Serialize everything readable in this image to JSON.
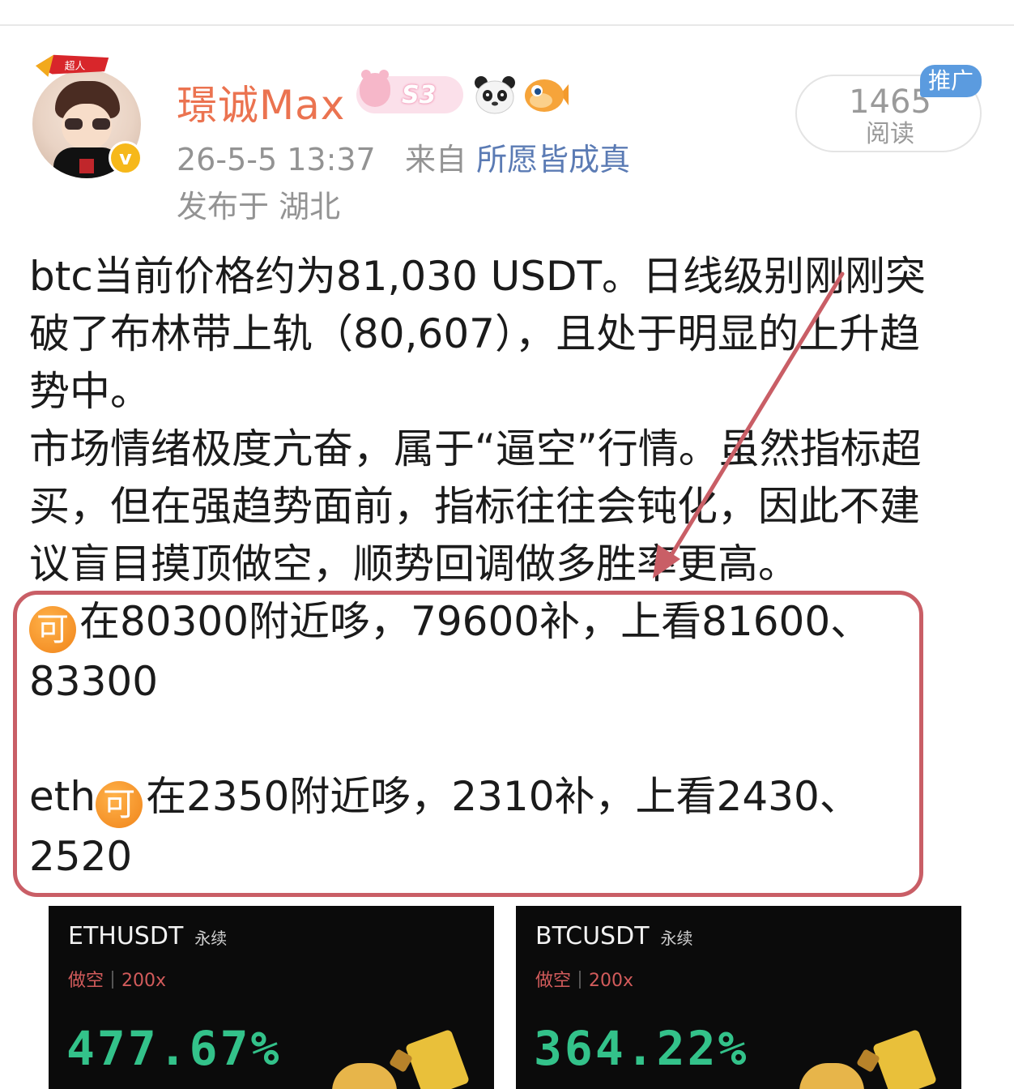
{
  "post": {
    "author": "璟诚Max",
    "avatar_tag": "超人",
    "badge_level": "S3",
    "timestamp": "26-5-5 13:37",
    "source_prefix": "来自",
    "source": "所愿皆成真",
    "location": "发布于 湖北",
    "read_count": "1465",
    "read_label": "阅读",
    "promo_label": "推广",
    "body_lines": [
      "btc当前价格约为81,030 USDT。日线级别刚刚突",
      "破了布林带上轨（80,607），且处于明显的上升趋",
      "势中。",
      "市场情绪极度亢奋，属于“逼空”行情。虽然指标超",
      "买，但在强趋势面前，指标往往会钝化，因此不建",
      "议盲目摸顶做空，顺势回调做多胜率更高。"
    ],
    "coin_glyph": "可",
    "btc_line": "在80300附近哆，79600补，上看81600、",
    "btc_line_cont": "83300",
    "eth_prefix": "eth",
    "eth_line": "在2350附近哆，2310补，上看2430、",
    "eth_line_cont": "2520"
  },
  "cards": [
    {
      "pair": "ETHUSDT",
      "perp": "永续",
      "side": "做空",
      "leverage": "200x",
      "pnl": "477.67%"
    },
    {
      "pair": "BTCUSDT",
      "perp": "永续",
      "side": "做空",
      "leverage": "200x",
      "pnl": "364.22%"
    }
  ],
  "colors": {
    "author": "#eb7350",
    "source_link": "#5b7bb4",
    "highlight_border": "#c95e66",
    "pnl_green": "#33c28a",
    "short_red": "#d25b5b",
    "promo_blue": "#5b9bdf"
  }
}
